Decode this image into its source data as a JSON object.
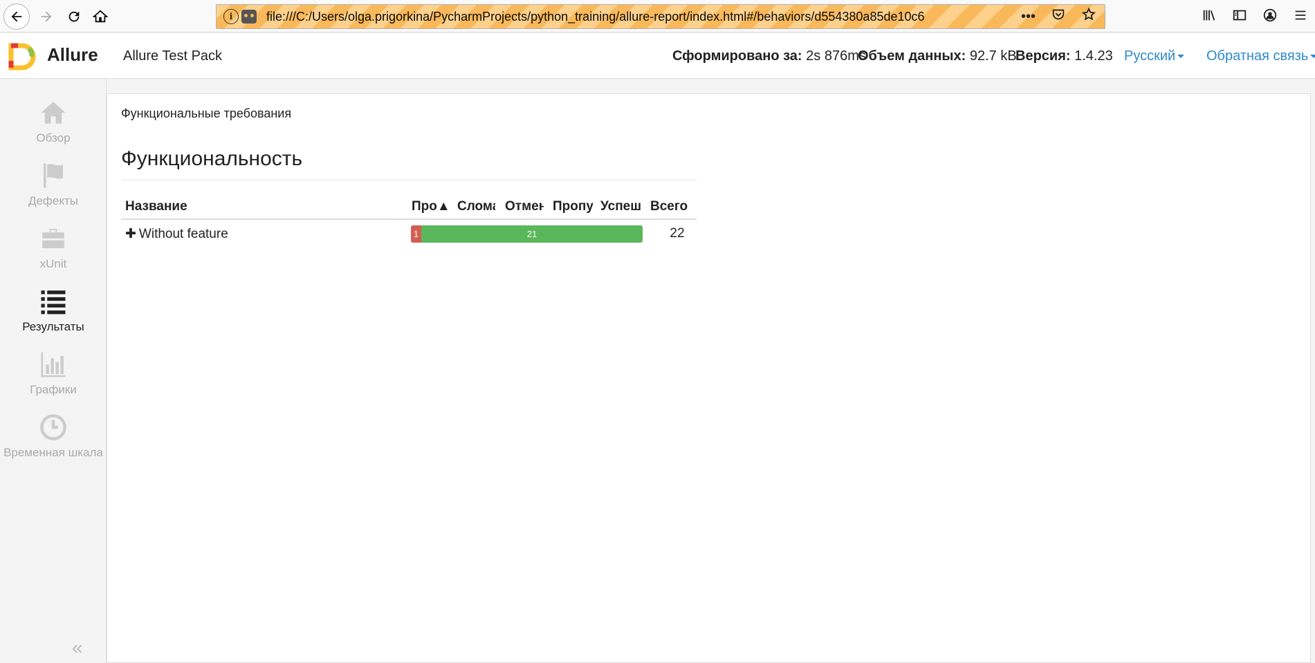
{
  "browser": {
    "url": "file:///C:/Users/olga.prigorkina/PycharmProjects/python_training/allure-report/index.html#/behaviors/d554380a85de10c6",
    "more_label": "•••"
  },
  "header": {
    "brand": "Allure",
    "report_name": "Allure Test Pack",
    "generated_label": "Сформировано за:",
    "generated_value": "2s 876ms",
    "size_label": "Объем данных:",
    "size_value": "92.7 kB",
    "version_label": "Версия:",
    "version_value": "1.4.23",
    "language": "Русский",
    "feedback": "Обратная связь"
  },
  "sidebar": {
    "items": [
      {
        "label": "Обзор",
        "icon": "home-icon"
      },
      {
        "label": "Дефекты",
        "icon": "flag-icon"
      },
      {
        "label": "xUnit",
        "icon": "briefcase-icon"
      },
      {
        "label": "Результаты",
        "icon": "list-icon",
        "active": true
      },
      {
        "label": "Графики",
        "icon": "bar-chart-icon"
      },
      {
        "label": "Временная шкала",
        "icon": "clock-icon"
      }
    ],
    "collapse_label": "«"
  },
  "main": {
    "breadcrumb": "Функциональные требования",
    "title": "Функциональность",
    "columns": [
      "Название",
      "Про▲",
      "Сломанные",
      "Отмененные",
      "Пропущенные",
      "Успешные",
      "Всего"
    ],
    "rows": [
      {
        "expander": "✚",
        "name": "Without feature",
        "failed": "1",
        "passed": "21",
        "total": "22",
        "failed_fraction": 0.045,
        "passed_fraction": 0.955
      }
    ]
  },
  "colors": {
    "failed": "#d35e52",
    "passed": "#5bb75b",
    "link": "#2d8acb"
  }
}
